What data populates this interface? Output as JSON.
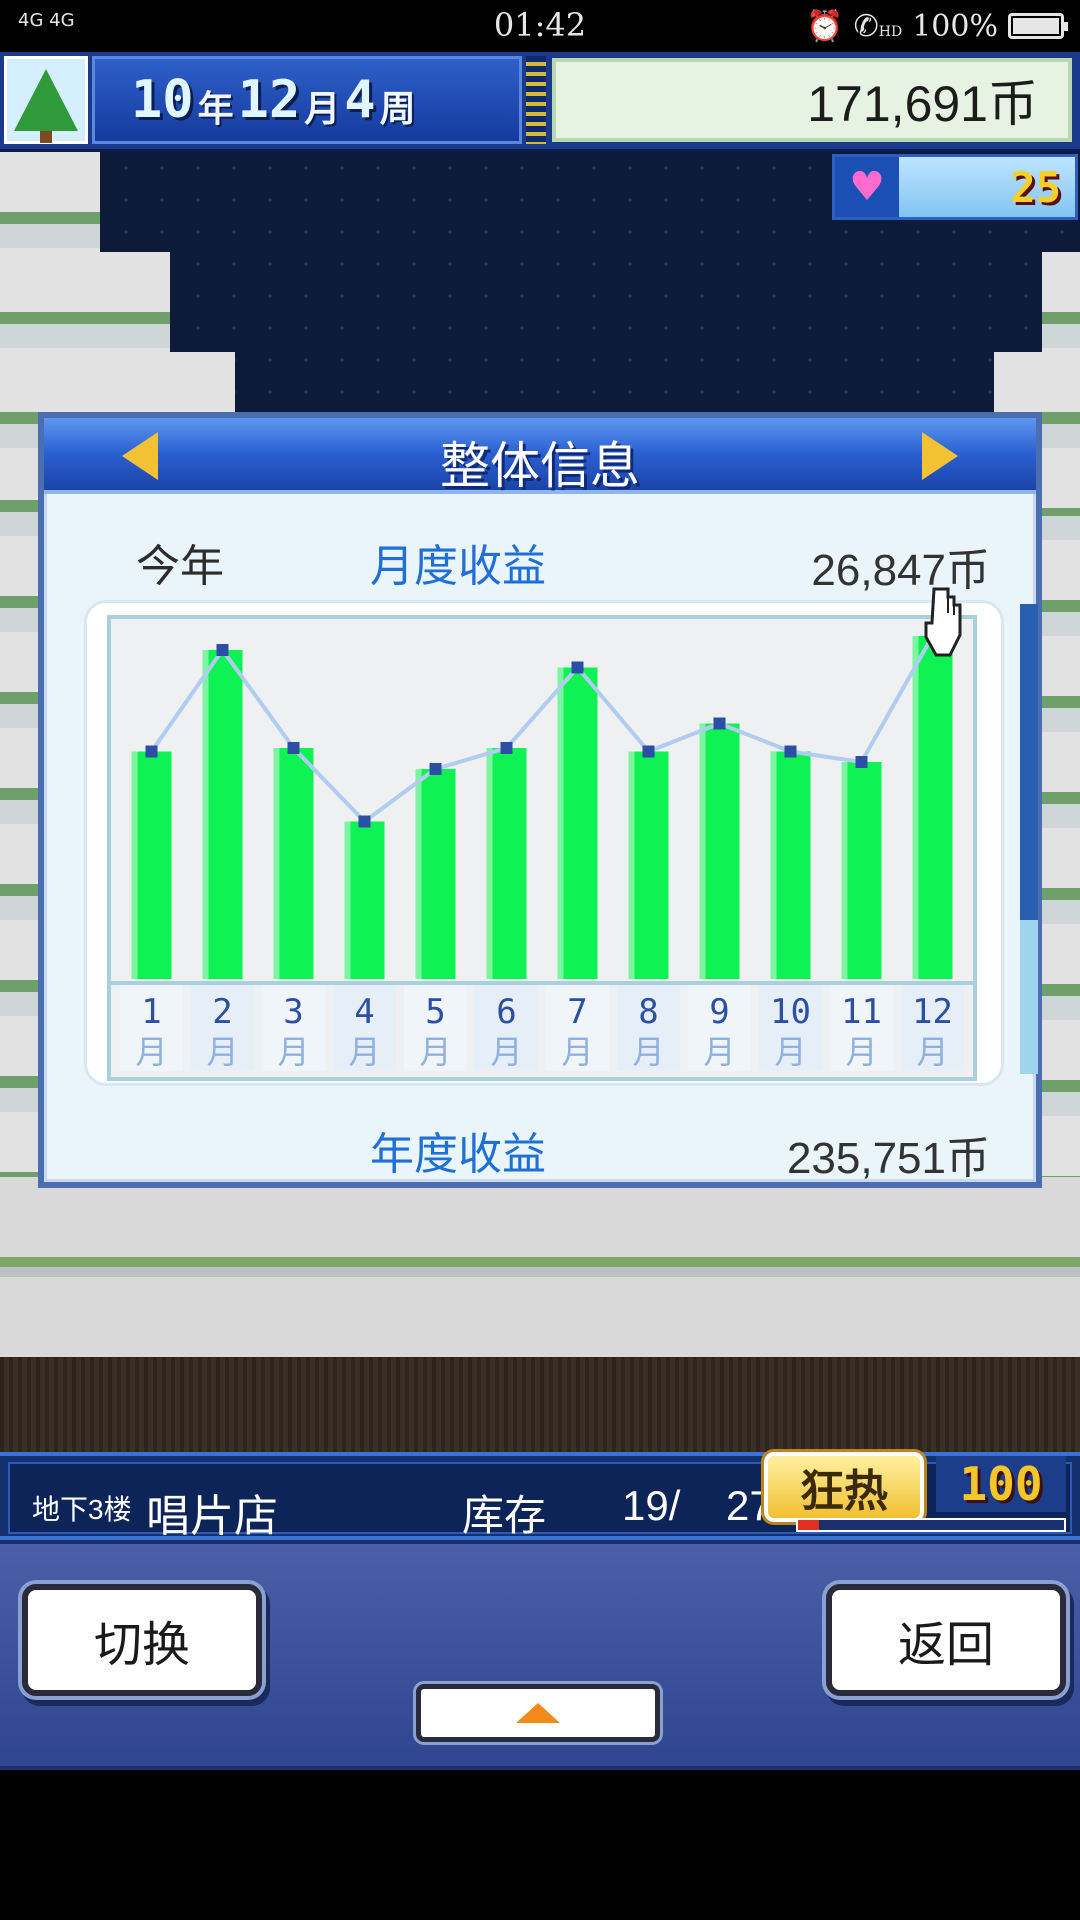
{
  "status_bar": {
    "signal": "4G 4G",
    "time": "01:42",
    "alarm_icon": "alarm-icon",
    "call_icon": "hd-call-icon",
    "hd": "HD",
    "battery": "100%"
  },
  "hud": {
    "year": "10",
    "year_unit": "年",
    "month": "12",
    "month_unit": "月",
    "week": "4",
    "week_unit": "周",
    "money": "171,691币",
    "hearts": "25"
  },
  "dialog": {
    "title": "整体信息",
    "period_label": "今年",
    "monthly_label": "月度收益",
    "monthly_value": "26,847币",
    "annual_label": "年度收益",
    "annual_value": "235,751币"
  },
  "chart_data": {
    "type": "bar",
    "categories": [
      "1\n月",
      "2\n月",
      "3\n月",
      "4\n月",
      "5\n月",
      "6\n月",
      "7\n月",
      "8\n月",
      "9\n月",
      "10\n月",
      "11\n月",
      "12\n月"
    ],
    "values": [
      65,
      94,
      66,
      45,
      60,
      66,
      89,
      65,
      73,
      65,
      62,
      98
    ],
    "ylim": [
      0,
      100
    ],
    "colors": {
      "bar": "#0ef254",
      "line": "#b0ccf0",
      "marker": "#2c4ea4"
    },
    "grid": false
  },
  "infobar": {
    "floor": "地下3楼",
    "shop": "唱片店",
    "stock_label": "库存",
    "stock_value": "19/",
    "stock_max": "27",
    "fever_label": "狂热",
    "fever_value": "100",
    "fever_level": 0.08
  },
  "buttons": {
    "switch": "切换",
    "back": "返回"
  }
}
